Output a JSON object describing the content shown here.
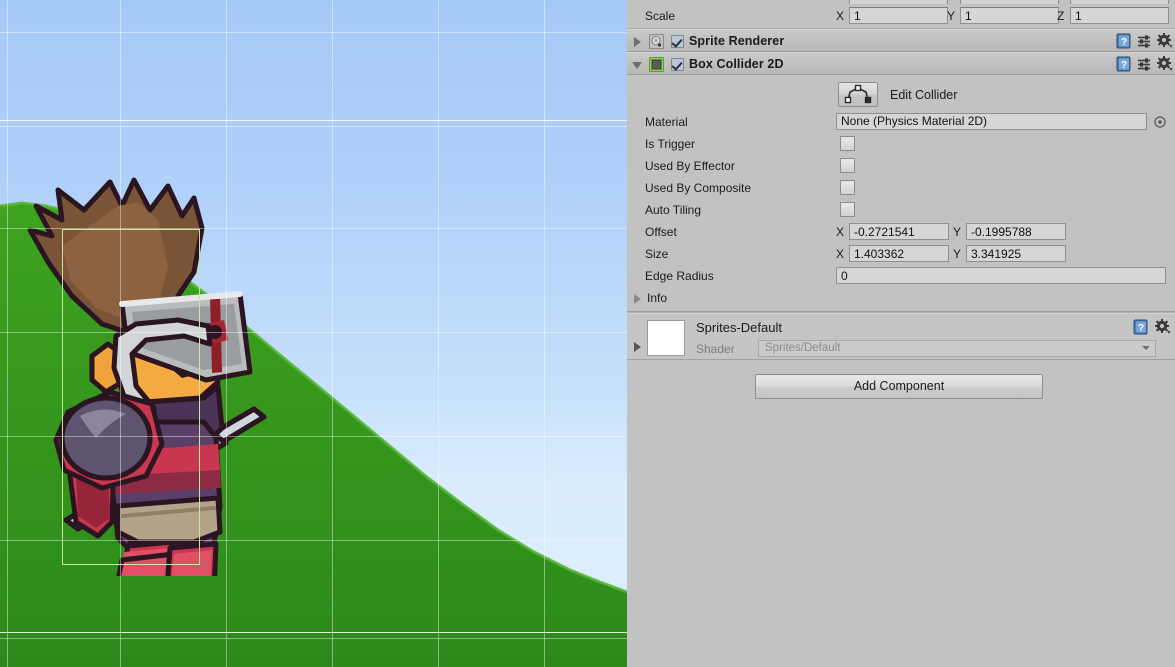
{
  "scene": {
    "name": "scene-view",
    "background_top": "#a6caf8",
    "background_bottom": "#dff0fd",
    "ground_color": "#2f8f1f",
    "gizmo_color": "#c6e89a",
    "grid_color": "#ffffff",
    "character_name": "knight-sprite",
    "collider_gizmo_name": "box-collider-gizmo"
  },
  "transform": {
    "scale_label": "Scale",
    "axes": [
      {
        "axis": "X",
        "value": "1"
      },
      {
        "axis": "Y",
        "value": "1"
      },
      {
        "axis": "Z",
        "value": "1"
      }
    ]
  },
  "components": [
    {
      "id": "sprite-renderer",
      "title": "Sprite Renderer",
      "expanded": false,
      "enabled": true
    },
    {
      "id": "box-collider-2d",
      "title": "Box Collider 2D",
      "expanded": true,
      "enabled": true
    }
  ],
  "box_collider": {
    "edit_collider_label": "Edit Collider",
    "edit_collider_icon": "polygon-edit-icon",
    "material": {
      "label": "Material",
      "value": "None (Physics Material 2D)",
      "picker_icon": "object-picker-icon"
    },
    "is_trigger": {
      "label": "Is Trigger",
      "checked": false
    },
    "used_by_effector": {
      "label": "Used By Effector",
      "checked": false
    },
    "used_by_composite": {
      "label": "Used By Composite",
      "checked": false
    },
    "auto_tiling": {
      "label": "Auto Tiling",
      "checked": false
    },
    "offset": {
      "label": "Offset",
      "x_axis": "X",
      "x_value": "-0.2721541",
      "y_axis": "Y",
      "y_value": "-0.1995788"
    },
    "size": {
      "label": "Size",
      "x_axis": "X",
      "x_value": "1.403362",
      "y_axis": "Y",
      "y_value": "3.341925"
    },
    "edge_radius": {
      "label": "Edge Radius",
      "value": "0"
    },
    "info": {
      "label": "Info",
      "expanded": false
    }
  },
  "material_block": {
    "name": "Sprites-Default",
    "shader_label": "Shader",
    "shader_value": "Sprites/Default",
    "swatch_color": "#ffffff"
  },
  "footer": {
    "add_component_label": "Add Component"
  },
  "icons": {
    "help": "help-book-icon",
    "preset": "preset-sliders-icon",
    "gear": "gear-icon"
  }
}
